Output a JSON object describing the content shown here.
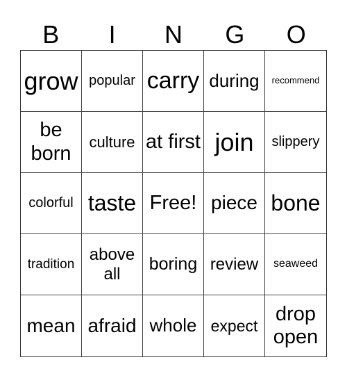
{
  "header": [
    "B",
    "I",
    "N",
    "G",
    "O"
  ],
  "cells": [
    "grow",
    "popular",
    "carry",
    "during",
    "recommend",
    "be born",
    "culture",
    "at first",
    "join",
    "slippery",
    "colorful",
    "taste",
    "Free!",
    "piece",
    "bone",
    "tradition",
    "above all",
    "boring",
    "review",
    "seaweed",
    "mean",
    "afraid",
    "whole",
    "expect",
    "drop open"
  ]
}
